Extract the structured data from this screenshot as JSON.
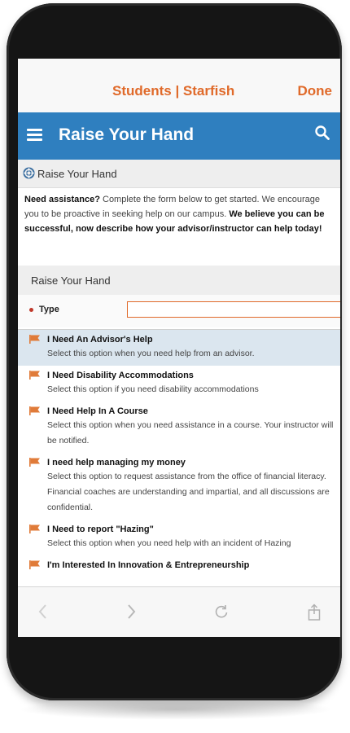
{
  "modal": {
    "title": "Students | Starfish",
    "done_label": "Done"
  },
  "app_header": {
    "title": "Raise Your Hand",
    "menu_icon": "hamburger-menu-icon",
    "search_icon": "search-icon"
  },
  "section": {
    "title": "Raise Your Hand",
    "icon": "lifebuoy-icon"
  },
  "intro": {
    "lead": "Need assistance?",
    "text": " Complete the form below to get started. We encourage you to be proactive in seeking help on our campus. ",
    "emphasis": "We believe you can be successful, now describe how your advisor/instructor can help today!"
  },
  "form": {
    "title": "Raise Your Hand",
    "type_label": "Type",
    "type_value": "",
    "options": [
      {
        "title": "I Need An Advisor's Help",
        "description": "Select this option when you need help from an advisor.",
        "selected": true
      },
      {
        "title": "I Need Disability Accommodations",
        "description": "Select this option if you need disability accommodations",
        "selected": false
      },
      {
        "title": "I Need Help In A Course",
        "description": "Select this option when you need assistance in a course. Your instructor will be notified.",
        "selected": false
      },
      {
        "title": "I need help managing my money",
        "description": "Select this option to request assistance from the office of financial literacy. Financial coaches are understanding and impartial, and all discussions are confidential.",
        "selected": false
      },
      {
        "title": "I Need to report \"Hazing\"",
        "description": "Select this option when you need help with an incident of Hazing",
        "selected": false
      },
      {
        "title": "I'm Interested In Innovation & Entrepreneurship",
        "description": "",
        "selected": false
      }
    ]
  },
  "colors": {
    "accent": "#e06a2a",
    "header_blue": "#2f7fbf",
    "selected_row": "#dbe6ef",
    "flag": "#e07b39"
  },
  "browser_bar": {
    "icons": [
      "back-icon",
      "forward-icon",
      "reload-icon",
      "share-icon"
    ]
  }
}
